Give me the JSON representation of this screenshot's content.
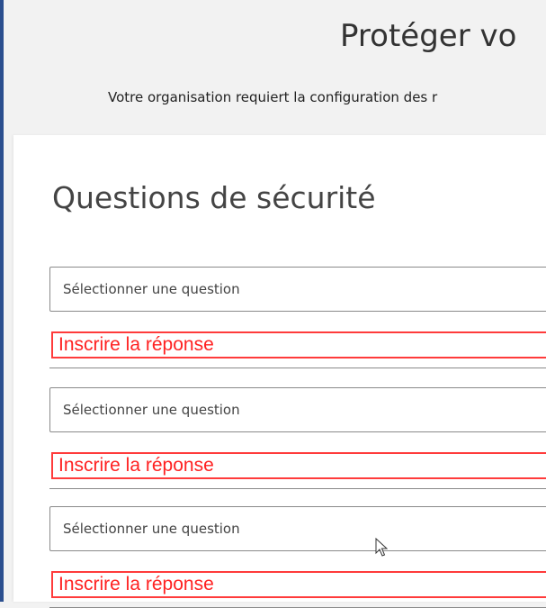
{
  "header": {
    "title": "Protéger vo",
    "subtitle": "Votre organisation requiert la configuration des r"
  },
  "form": {
    "section_title": "Questions de sécurité",
    "questions": [
      {
        "select_value": "Sélectionner une question",
        "answer_placeholder": "Inscrire la réponse"
      },
      {
        "select_value": "Sélectionner une question",
        "answer_placeholder": "Inscrire la réponse"
      },
      {
        "select_value": "Sélectionner une question",
        "answer_placeholder": "Inscrire la réponse"
      }
    ]
  },
  "colors": {
    "annotation_red": "#ff2222",
    "field_border": "#8a8a8a",
    "edge_blue": "#2b4f8f"
  }
}
